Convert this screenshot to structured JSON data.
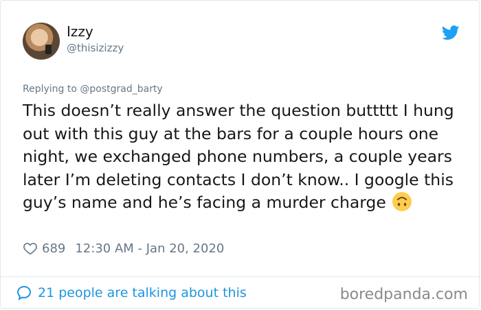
{
  "author": {
    "name": "Izzy",
    "handle": "@thisizizzy"
  },
  "reply_context": "Replying to @postgrad_barty",
  "tweet": {
    "text": "This doesn’t really answer the question buttttt I hung out with this guy at the bars for a couple hours one night, we exchanged phone numbers, a couple years later I’m deleting contacts I don’t know.. I google this guy’s name and he’s facing a murder charge",
    "emoji": "upside-down-face-emoji"
  },
  "meta": {
    "likes": "689",
    "timestamp": "12:30 AM - Jan 20, 2020"
  },
  "footer": {
    "talking": "21 people are talking about this",
    "watermark": "boredpanda.com"
  },
  "icons": {
    "brand": "twitter-bird-icon",
    "like": "heart-icon",
    "comments": "speech-bubble-icon"
  },
  "colors": {
    "twitter_blue": "#1da1f2",
    "link_blue": "#1b95e0",
    "text": "#14171a",
    "secondary": "#657786",
    "emoji_yellow": "#ffcc4d"
  }
}
